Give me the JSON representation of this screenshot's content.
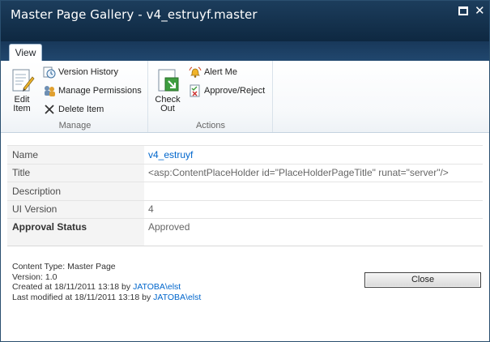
{
  "window": {
    "title": "Master Page Gallery - v4_estruyf.master"
  },
  "ribbon": {
    "active_tab": "View",
    "groups": {
      "manage": {
        "label": "Manage",
        "edit_item": [
          "Edit",
          "Item"
        ],
        "version_history": "Version History",
        "manage_permissions": "Manage Permissions",
        "delete_item": "Delete Item"
      },
      "actions": {
        "label": "Actions",
        "check_out": [
          "Check",
          "Out"
        ],
        "alert_me": "Alert Me",
        "approve_reject": "Approve/Reject"
      }
    }
  },
  "properties": [
    {
      "label": "Name",
      "value": "v4_estruyf"
    },
    {
      "label": "Title",
      "value": "<asp:ContentPlaceHolder id=\"PlaceHolderPageTitle\" runat=\"server\"/>"
    },
    {
      "label": "Description",
      "value": ""
    },
    {
      "label": "UI Version",
      "value": "4"
    },
    {
      "label": "Approval Status",
      "value": "Approved"
    }
  ],
  "footer": {
    "content_type": "Content Type: Master Page",
    "version": "Version: 1.0",
    "created_prefix": "Created at 18/11/2011 13:18 by ",
    "created_by": "JATOBA\\elst",
    "modified_prefix": "Last modified at 18/11/2011 13:18 by ",
    "modified_by": "JATOBA\\elst",
    "close_label": "Close"
  }
}
